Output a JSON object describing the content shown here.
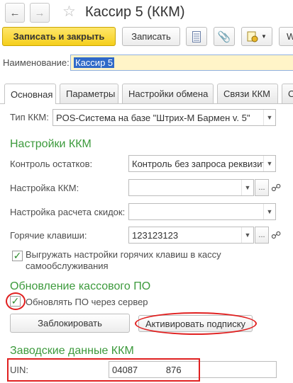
{
  "window": {
    "title": "Кассир 5 (ККМ)"
  },
  "toolbar": {
    "save_close_label": "Записать и закрыть",
    "save_label": "Записать",
    "more_label": "W"
  },
  "name": {
    "label": "Наименование:",
    "value": "Кассир 5"
  },
  "tabs": [
    {
      "label": "Основная"
    },
    {
      "label": "Параметры"
    },
    {
      "label": "Настройки обмена"
    },
    {
      "label": "Связи ККМ"
    },
    {
      "label": "ОФ"
    }
  ],
  "kkm_type": {
    "label": "Тип ККМ:",
    "value": "POS-Система на базе \"Штрих-М Бармен v. 5\""
  },
  "kkm_settings": {
    "header": "Настройки ККМ",
    "stock_control": {
      "label": "Контроль остатков:",
      "value": "Контроль без запроса реквизитов"
    },
    "kkm_setting": {
      "label": "Настройка ККМ:",
      "value": ""
    },
    "discount_setting": {
      "label": "Настройка расчета скидок:",
      "value": ""
    },
    "hotkeys": {
      "label": "Горячие клавиши:",
      "value": "123123123"
    },
    "upload_hotkeys": {
      "label": "Выгружать настройки горячих клавиш в кассу самообслуживания",
      "checked": true
    }
  },
  "software_update": {
    "header": "Обновление кассового ПО",
    "update_via_server": {
      "label": "Обновлять ПО через сервер",
      "checked": true
    },
    "lock_label": "Заблокировать",
    "activate_label": "Активировать подписку"
  },
  "factory_data": {
    "header": "Заводские данные ККМ",
    "uin": {
      "label": "UIN:",
      "value": "04087           876"
    }
  },
  "colors": {
    "accent_yellow": "#f5cf1c",
    "section_green": "#3c9a3c",
    "highlight_red": "#e02020",
    "selection_blue": "#2f69c8"
  }
}
